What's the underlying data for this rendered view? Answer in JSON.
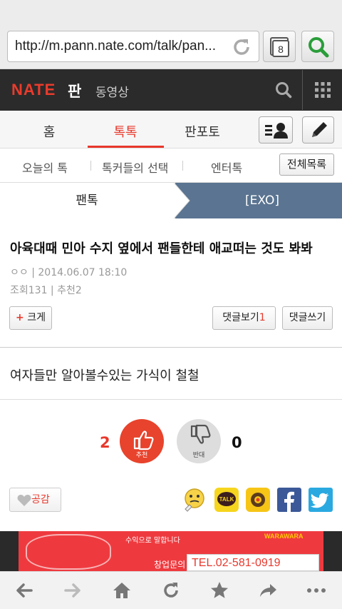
{
  "browser": {
    "url": "http://m.pann.nate.com/talk/pan...",
    "tabs_count": "8"
  },
  "header": {
    "logo": "NATE",
    "site": "판",
    "video_link": "동영상"
  },
  "tabs": [
    {
      "label": "홈"
    },
    {
      "label": "톡톡",
      "active": true
    },
    {
      "label": "판포토"
    }
  ],
  "subnav": {
    "items": [
      "오늘의 톡",
      "톡커들의 선택",
      "엔터톡"
    ],
    "all_list": "전체목록"
  },
  "category": {
    "left": "팬톡",
    "right": "[EXO]"
  },
  "post": {
    "title": "아육대때 민아 수지 옆에서 팬들한테 애교떠는 것도 봐봐",
    "meta": "ㅇㅇ | 2014.06.07 18:10",
    "stats": "조회131 | 추천2",
    "enlarge": "크게",
    "enlarge_mark": "+",
    "comments_view": "댓글보기",
    "comments_count": "1",
    "comment_write": "댓글쓰기",
    "body": "여자들만 알아볼수있는 가식이 철철"
  },
  "votes": {
    "recommend_count": "2",
    "recommend_label": "추천",
    "oppose_label": "반대",
    "oppose_count": "0"
  },
  "share": {
    "like_label": "공감",
    "kakaotalk_label": "TALK"
  },
  "ad": {
    "line1": "수익으로 말합니다",
    "phone": "TEL.02-581-0919",
    "text2": "창업문의",
    "brand": "WARAWARA"
  },
  "colors": {
    "accent": "#e8382c",
    "header_bg": "#2b2b2b",
    "category_bg": "#5a7491"
  }
}
